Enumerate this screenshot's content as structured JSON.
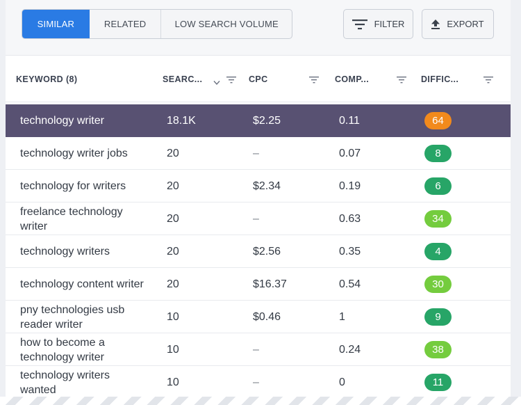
{
  "tabs": [
    {
      "label": "SIMILAR",
      "active": true
    },
    {
      "label": "RELATED",
      "active": false
    },
    {
      "label": "LOW SEARCH VOLUME",
      "active": false
    }
  ],
  "toolbar": {
    "filter_label": "FILTER",
    "filter_icon": "filter-lines-icon",
    "export_label": "EXPORT",
    "export_icon": "upload-arrow-icon"
  },
  "columns": {
    "keyword": "KEYWORD (8)",
    "search": "SEARC...",
    "cpc": "CPC",
    "comp": "COMP...",
    "difficulty": "DIFFIC..."
  },
  "colors": {
    "accent": "#2a7be4",
    "row_highlight": "#585172",
    "difficulty_orange": "#f28a1c",
    "difficulty_dark_green": "#27a567",
    "difficulty_light_green": "#74cc3e"
  },
  "rows": [
    {
      "keyword": "technology writer",
      "search": "18.1K",
      "cpc": "$2.25",
      "comp": "0.11",
      "difficulty": "64",
      "difficulty_color": "#f28a1c",
      "highlighted": true
    },
    {
      "keyword": "technology writer jobs",
      "search": "20",
      "cpc": "–",
      "comp": "0.07",
      "difficulty": "8",
      "difficulty_color": "#27a567"
    },
    {
      "keyword": "technology for writers",
      "search": "20",
      "cpc": "$2.34",
      "comp": "0.19",
      "difficulty": "6",
      "difficulty_color": "#27a567"
    },
    {
      "keyword": "freelance technology writer",
      "search": "20",
      "cpc": "–",
      "comp": "0.63",
      "difficulty": "34",
      "difficulty_color": "#74cc3e"
    },
    {
      "keyword": "technology writers",
      "search": "20",
      "cpc": "$2.56",
      "comp": "0.35",
      "difficulty": "4",
      "difficulty_color": "#27a567"
    },
    {
      "keyword": "technology content writer",
      "search": "20",
      "cpc": "$16.37",
      "comp": "0.54",
      "difficulty": "30",
      "difficulty_color": "#74cc3e"
    },
    {
      "keyword": "pny technologies usb reader writer",
      "search": "10",
      "cpc": "$0.46",
      "comp": "1",
      "difficulty": "9",
      "difficulty_color": "#27a567"
    },
    {
      "keyword": "how to become a technology writer",
      "search": "10",
      "cpc": "–",
      "comp": "0.24",
      "difficulty": "38",
      "difficulty_color": "#74cc3e"
    },
    {
      "keyword": "technology writers wanted",
      "search": "10",
      "cpc": "–",
      "comp": "0",
      "difficulty": "11",
      "difficulty_color": "#27a567"
    }
  ]
}
